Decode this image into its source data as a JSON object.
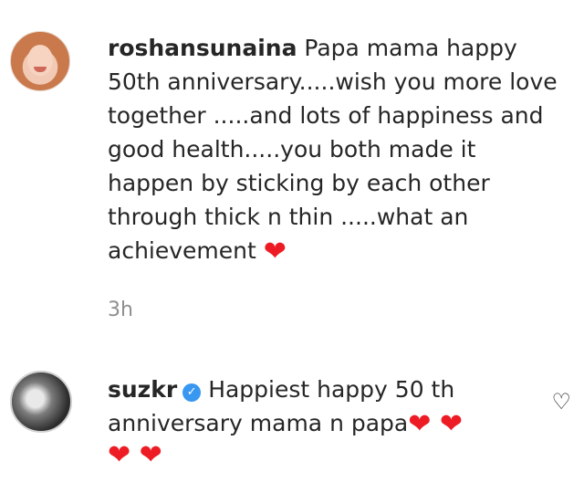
{
  "comments": [
    {
      "username": "roshansunaina",
      "text": "Papa mama happy 50th anniversary.....wish you more love together .....and lots of happiness and good health.....you both made it happen by sticking by each other through thick n thin .....what an achievement",
      "emoji": "❤",
      "time": "3h"
    },
    {
      "username": "suzkr",
      "verified": true,
      "text": "Happiest happy 50 th anniversary mama n papa",
      "emoji_inline": "❤ ❤",
      "emoji_line": "❤ ❤"
    }
  ],
  "icons": {
    "like": "heart-outline-icon",
    "verified": "verified-badge-icon"
  },
  "colors": {
    "heart": "#ed1c24",
    "verified": "#3897f0",
    "meta": "#8e8e8e"
  }
}
